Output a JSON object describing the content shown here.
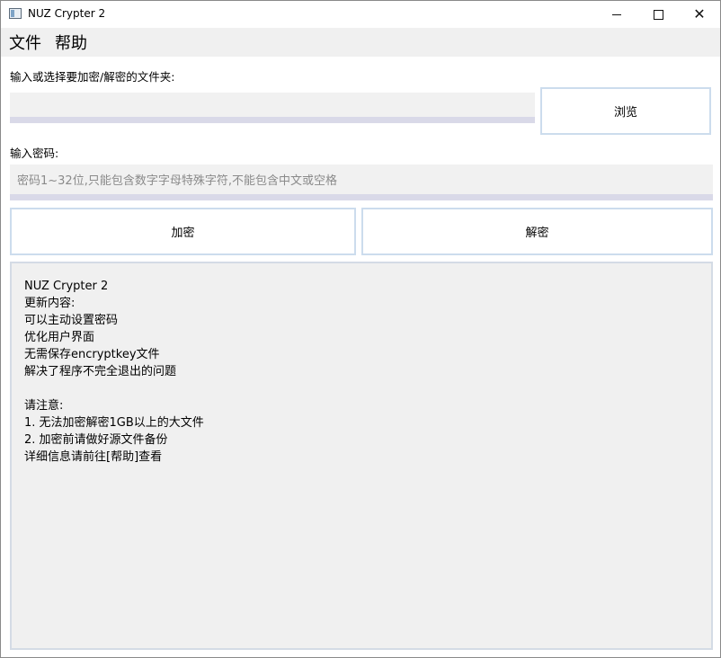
{
  "window": {
    "title": "NUZ Crypter 2",
    "controls": {
      "minimize": "—",
      "maximize": "☐",
      "close": "✕"
    }
  },
  "menu": {
    "items": [
      {
        "label": "文件"
      },
      {
        "label": "帮助"
      }
    ]
  },
  "folder": {
    "label": "输入或选择要加密/解密的文件夹:",
    "value": "",
    "browse_label": "浏览"
  },
  "password": {
    "label": "输入密码:",
    "placeholder": "密码1~32位,只能包含数字字母特殊字符,不能包含中文或空格"
  },
  "actions": {
    "encrypt_label": "加密",
    "decrypt_label": "解密"
  },
  "log": {
    "lines": [
      "NUZ Crypter 2",
      "更新内容:",
      "可以主动设置密码",
      "优化用户界面",
      "无需保存encryptkey文件",
      "解决了程序不完全退出的问题",
      "",
      "请注意:",
      "1. 无法加密解密1GB以上的大文件",
      "2. 加密前请做好源文件备份",
      "详细信息请前往[帮助]查看"
    ]
  },
  "colors": {
    "menubar_bg": "#f0f0f0",
    "input_bg": "#f1f1f1",
    "input_underline": "#d9d9e8",
    "button_border": "#ccdced",
    "log_bg": "#f0f0f0"
  }
}
